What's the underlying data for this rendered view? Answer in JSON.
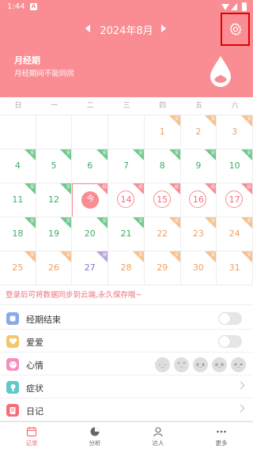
{
  "status_bar": {
    "time": "1:44",
    "notification_icon": "A"
  },
  "header": {
    "month_label": "2024年8月",
    "period_title": "月经期",
    "period_subtitle": "月经期间不能同房",
    "accent_color": "#f98d93"
  },
  "weekdays": [
    "日",
    "一",
    "二",
    "三",
    "四",
    "五",
    "六"
  ],
  "calendar": {
    "corner_labels": {
      "g": "安",
      "o": "安",
      "r": "经",
      "p": "排"
    },
    "cells": [
      {
        "day": "",
        "color": "none",
        "corner": "none"
      },
      {
        "day": "",
        "color": "none",
        "corner": "none"
      },
      {
        "day": "",
        "color": "none",
        "corner": "none"
      },
      {
        "day": "",
        "color": "none",
        "corner": "none"
      },
      {
        "day": "1",
        "color": "orange",
        "corner": "o"
      },
      {
        "day": "2",
        "color": "orange",
        "corner": "o"
      },
      {
        "day": "3",
        "color": "orange",
        "corner": "o"
      },
      {
        "day": "4",
        "color": "green",
        "corner": "g"
      },
      {
        "day": "5",
        "color": "green",
        "corner": "g"
      },
      {
        "day": "6",
        "color": "green",
        "corner": "g"
      },
      {
        "day": "7",
        "color": "green",
        "corner": "g"
      },
      {
        "day": "8",
        "color": "green",
        "corner": "g"
      },
      {
        "day": "9",
        "color": "green",
        "corner": "g"
      },
      {
        "day": "10",
        "color": "green",
        "corner": "g"
      },
      {
        "day": "11",
        "color": "green",
        "corner": "g"
      },
      {
        "day": "12",
        "color": "green",
        "corner": "g"
      },
      {
        "day": "今",
        "color": "today",
        "corner": "r"
      },
      {
        "day": "14",
        "color": "red",
        "corner": "r"
      },
      {
        "day": "15",
        "color": "red",
        "corner": "r"
      },
      {
        "day": "16",
        "color": "red",
        "corner": "r"
      },
      {
        "day": "17",
        "color": "red",
        "corner": "r"
      },
      {
        "day": "18",
        "color": "green",
        "corner": "g"
      },
      {
        "day": "19",
        "color": "green",
        "corner": "g"
      },
      {
        "day": "20",
        "color": "green",
        "corner": "g"
      },
      {
        "day": "21",
        "color": "green",
        "corner": "g"
      },
      {
        "day": "22",
        "color": "orange",
        "corner": "o"
      },
      {
        "day": "23",
        "color": "orange",
        "corner": "o"
      },
      {
        "day": "24",
        "color": "orange",
        "corner": "o"
      },
      {
        "day": "25",
        "color": "orange",
        "corner": "o"
      },
      {
        "day": "26",
        "color": "orange",
        "corner": "o"
      },
      {
        "day": "27",
        "color": "purple",
        "corner": "p"
      },
      {
        "day": "28",
        "color": "orange",
        "corner": "o"
      },
      {
        "day": "29",
        "color": "orange",
        "corner": "o"
      },
      {
        "day": "30",
        "color": "orange",
        "corner": "o"
      },
      {
        "day": "31",
        "color": "orange",
        "corner": "o"
      }
    ]
  },
  "sync_note": "登录后可将数据同步到云端,永久保存哦~",
  "records": [
    {
      "label": "经期结束",
      "control": "toggle",
      "icon": "drop-icon",
      "icon_color": "#8aa9e8"
    },
    {
      "label": "爱爱",
      "control": "toggle",
      "icon": "heart-icon",
      "icon_color": "#f7c46a"
    },
    {
      "label": "心情",
      "control": "moods",
      "icon": "smile-icon",
      "icon_color": "#f58fc0"
    },
    {
      "label": "症状",
      "control": "chevron",
      "icon": "symptom-icon",
      "icon_color": "#5fc9c9"
    },
    {
      "label": "日记",
      "control": "chevron",
      "icon": "diary-icon",
      "icon_color": "#f36f79"
    }
  ],
  "moods": [
    {
      "name": "mood-1",
      "face": "-_-"
    },
    {
      "name": "mood-2",
      "face": "^_^"
    },
    {
      "name": "mood-3",
      "face": "x_x"
    },
    {
      "name": "mood-4",
      "face": "o_o"
    },
    {
      "name": "mood-5",
      "face": "=_="
    }
  ],
  "tabs": [
    {
      "label": "记录",
      "icon": "calendar-icon",
      "active": true
    },
    {
      "label": "分析",
      "icon": "pie-chart-icon",
      "active": false
    },
    {
      "label": "达人",
      "icon": "person-icon",
      "active": false
    },
    {
      "label": "更多",
      "icon": "more-icon",
      "active": false
    }
  ]
}
